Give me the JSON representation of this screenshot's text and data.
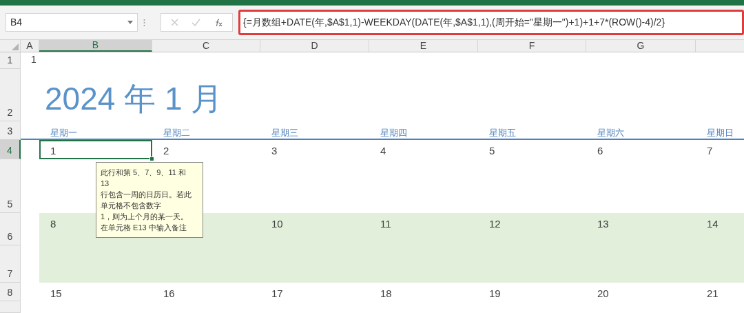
{
  "name_box": "B4",
  "formula": "{=月数组+DATE(年,$A$1,1)-WEEKDAY(DATE(年,$A$1,1),(周开始=\"星期一\")+1)+1+7*(ROW()-4)/2}",
  "columns": [
    {
      "label": "A",
      "selected": false
    },
    {
      "label": "B",
      "selected": true
    },
    {
      "label": "C",
      "selected": false
    },
    {
      "label": "D",
      "selected": false
    },
    {
      "label": "E",
      "selected": false
    },
    {
      "label": "F",
      "selected": false
    },
    {
      "label": "G",
      "selected": false
    }
  ],
  "rows": [
    {
      "label": "1",
      "selected": false
    },
    {
      "label": "2",
      "selected": false
    },
    {
      "label": "3",
      "selected": false
    },
    {
      "label": "4",
      "selected": true
    },
    {
      "label": "5",
      "selected": false
    },
    {
      "label": "6",
      "selected": false
    },
    {
      "label": "7",
      "selected": false
    },
    {
      "label": "8",
      "selected": false
    }
  ],
  "a1_value": "1",
  "calendar_title": "2024 年 1 月",
  "weekdays": [
    "星期一",
    "星期二",
    "星期三",
    "星期四",
    "星期五",
    "星期六",
    "星期日"
  ],
  "weeks": [
    {
      "shaded": false,
      "days": [
        {
          "kind": "date",
          "text": "1",
          "selected": true
        },
        {
          "kind": "date",
          "text": "2",
          "selected": false
        },
        {
          "kind": "date",
          "text": "3",
          "selected": false
        },
        {
          "kind": "date",
          "text": "4",
          "selected": false
        },
        {
          "kind": "date",
          "text": "5",
          "selected": false
        },
        {
          "kind": "date",
          "text": "6",
          "selected": false
        },
        {
          "kind": "date",
          "text": "7",
          "selected": false
        }
      ]
    },
    {
      "shaded": true,
      "days": [
        {
          "kind": "date",
          "text": "8",
          "selected": false
        },
        {
          "kind": "covered"
        },
        {
          "kind": "date",
          "text": "10",
          "selected": false
        },
        {
          "kind": "date",
          "text": "11",
          "selected": false
        },
        {
          "kind": "date",
          "text": "12",
          "selected": false
        },
        {
          "kind": "date",
          "text": "13",
          "selected": false
        },
        {
          "kind": "date",
          "text": "14",
          "selected": false
        }
      ]
    },
    {
      "shaded": false,
      "days": [
        {
          "kind": "date",
          "text": "15",
          "selected": false
        },
        {
          "kind": "date",
          "text": "16",
          "selected": false
        },
        {
          "kind": "date",
          "text": "17",
          "selected": false
        },
        {
          "kind": "date",
          "text": "18",
          "selected": false
        },
        {
          "kind": "date",
          "text": "19",
          "selected": false
        },
        {
          "kind": "date",
          "text": "20",
          "selected": false
        },
        {
          "kind": "date",
          "text": "21",
          "selected": false
        }
      ]
    }
  ],
  "comment": [
    "此行和第 5、7、9、11 和",
    "13",
    "行包含一周的日历日。若此",
    "单元格不包含数字",
    "1，则为上个月的某一天。",
    "在单元格 E13 中输入备注"
  ]
}
